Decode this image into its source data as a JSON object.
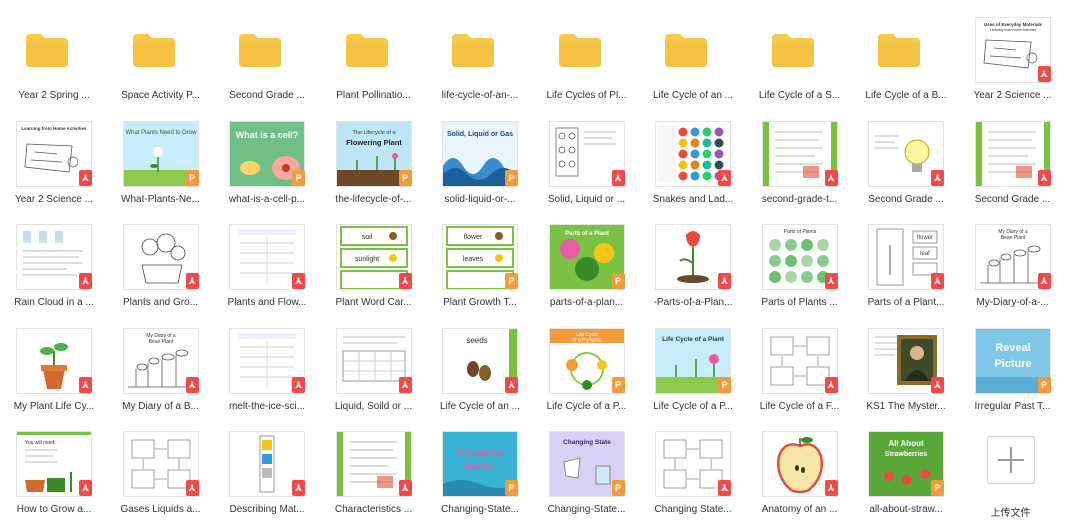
{
  "upload": {
    "label": "上传文件"
  },
  "items": [
    {
      "label": "Year 2 Spring ...",
      "kind": "folder",
      "thumb": "folder",
      "badge": ""
    },
    {
      "label": "Space Activity P...",
      "kind": "folder",
      "thumb": "folder",
      "badge": ""
    },
    {
      "label": "Second Grade ...",
      "kind": "folder",
      "thumb": "folder",
      "badge": ""
    },
    {
      "label": "Plant Pollinatio...",
      "kind": "folder",
      "thumb": "folder",
      "badge": ""
    },
    {
      "label": "life-cycle-of-an-...",
      "kind": "folder",
      "thumb": "folder",
      "badge": ""
    },
    {
      "label": "Life Cycles of Pl...",
      "kind": "folder",
      "thumb": "folder",
      "badge": ""
    },
    {
      "label": "Life Cycle of an ...",
      "kind": "folder",
      "thumb": "folder",
      "badge": ""
    },
    {
      "label": "Life Cycle of a S...",
      "kind": "folder",
      "thumb": "folder",
      "badge": ""
    },
    {
      "label": "Life Cycle of a B...",
      "kind": "folder",
      "thumb": "folder",
      "badge": ""
    },
    {
      "label": "Year 2 Science ...",
      "kind": "pdf",
      "thumb": "doc-sketch",
      "badge": "pdf",
      "title": "Uses of Everyday Materials",
      "sub": "Learning from Home Activities"
    },
    {
      "label": "Year 2 Science ...",
      "kind": "pdf",
      "thumb": "doc-sketch",
      "badge": "pdf",
      "title": "Learning from Home Activities",
      "sub": ""
    },
    {
      "label": "What-Plants-Ne...",
      "kind": "ppt",
      "thumb": "green-plant",
      "badge": "ppt",
      "title": "What Plants Need to Grow",
      "sub": ""
    },
    {
      "label": "what-is-a-cell-p...",
      "kind": "ppt",
      "thumb": "cell",
      "badge": "ppt",
      "title": "What is a cell?",
      "sub": ""
    },
    {
      "label": "the-lifecycle-of-...",
      "kind": "ppt",
      "thumb": "flowering",
      "badge": "ppt",
      "title": "The Lifecycle of a",
      "sub": "Flowering Plant"
    },
    {
      "label": "solid-liquid-or-...",
      "kind": "ppt",
      "thumb": "wave",
      "badge": "ppt",
      "title": "Solid, Liquid or Gas",
      "sub": ""
    },
    {
      "label": "Solid, Liquid or ...",
      "kind": "pdf",
      "thumb": "doc-grid",
      "badge": "pdf",
      "title": "",
      "sub": ""
    },
    {
      "label": "Snakes and Lad...",
      "kind": "pdf",
      "thumb": "dots",
      "badge": "pdf",
      "title": "",
      "sub": ""
    },
    {
      "label": "second-grade-t...",
      "kind": "pdf",
      "thumb": "green-list",
      "badge": "pdf",
      "title": "",
      "sub": ""
    },
    {
      "label": "Second Grade ...",
      "kind": "pdf",
      "thumb": "bulb",
      "badge": "pdf",
      "title": "",
      "sub": ""
    },
    {
      "label": "Second Grade ...",
      "kind": "pdf",
      "thumb": "green-list",
      "badge": "pdf",
      "title": "",
      "sub": ""
    },
    {
      "label": "Rain Cloud in a ...",
      "kind": "pdf",
      "thumb": "doc-text",
      "badge": "pdf",
      "title": "",
      "sub": ""
    },
    {
      "label": "Plants and Gro...",
      "kind": "pdf",
      "thumb": "sketch-flowers",
      "badge": "pdf",
      "title": "",
      "sub": ""
    },
    {
      "label": "Plants and Flow...",
      "kind": "pdf",
      "thumb": "doc-lines",
      "badge": "pdf",
      "title": "",
      "sub": ""
    },
    {
      "label": "Plant Word Car...",
      "kind": "pdf",
      "thumb": "word-cards",
      "badge": "pdf",
      "title": "soil",
      "sub": "sunlight"
    },
    {
      "label": "Plant Growth T...",
      "kind": "ppt",
      "thumb": "word-cards",
      "badge": "ppt",
      "title": "flower",
      "sub": "leaves"
    },
    {
      "label": "parts-of-a-plan...",
      "kind": "ppt",
      "thumb": "garden",
      "badge": "ppt",
      "title": "Parts of a Plant",
      "sub": ""
    },
    {
      "label": "-Parts-of-a-Plan...",
      "kind": "pdf",
      "thumb": "tulip",
      "badge": "pdf",
      "title": "",
      "sub": ""
    },
    {
      "label": "Parts of Plants ...",
      "kind": "pdf",
      "thumb": "plants-grid",
      "badge": "pdf",
      "title": "Parts of Plants",
      "sub": ""
    },
    {
      "label": "Parts of a Plant...",
      "kind": "pdf",
      "thumb": "doc-plant",
      "badge": "pdf",
      "title": "flower",
      "sub": "leaf"
    },
    {
      "label": "My-Diary-of-a-...",
      "kind": "pdf",
      "thumb": "sketch-bean",
      "badge": "pdf",
      "title": "My Diary of a",
      "sub": "Bean Plant"
    },
    {
      "label": "My Plant Life Cy...",
      "kind": "pdf",
      "thumb": "pot",
      "badge": "pdf",
      "title": "",
      "sub": ""
    },
    {
      "label": "My Diary of a B...",
      "kind": "pdf",
      "thumb": "sketch-bean",
      "badge": "pdf",
      "title": "My Diary of a",
      "sub": "Bean Plant"
    },
    {
      "label": "melt-the-ice-sci...",
      "kind": "pdf",
      "thumb": "doc-lines",
      "badge": "pdf",
      "title": "",
      "sub": ""
    },
    {
      "label": "Liquid, Soild or ...",
      "kind": "pdf",
      "thumb": "doc-table",
      "badge": "pdf",
      "title": "",
      "sub": ""
    },
    {
      "label": "Life Cycle of an ...",
      "kind": "pdf",
      "thumb": "seeds",
      "badge": "pdf",
      "title": "seeds",
      "sub": ""
    },
    {
      "label": "Life Cycle of a P...",
      "kind": "ppt",
      "thumb": "pumpkin",
      "badge": "ppt",
      "title": "Life Cycle",
      "sub": "of a Pumpkin"
    },
    {
      "label": "Life Cycle of a P...",
      "kind": "ppt",
      "thumb": "plant-cycle",
      "badge": "ppt",
      "title": "Life Cycle of a Plant",
      "sub": ""
    },
    {
      "label": "Life Cycle of a F...",
      "kind": "pdf",
      "thumb": "doc-cycle",
      "badge": "pdf",
      "title": "",
      "sub": ""
    },
    {
      "label": "KS1 The Myster...",
      "kind": "pdf",
      "thumb": "mona",
      "badge": "pdf",
      "title": "",
      "sub": ""
    },
    {
      "label": "Irregular Past T...",
      "kind": "ppt",
      "thumb": "reveal",
      "badge": "ppt",
      "title": "Reveal",
      "sub": "Picture"
    },
    {
      "label": "How to Grow a...",
      "kind": "pdf",
      "thumb": "grow",
      "badge": "pdf",
      "title": "You will need:",
      "sub": ""
    },
    {
      "label": "Gases Liquids a...",
      "kind": "pdf",
      "thumb": "doc-cycle",
      "badge": "pdf",
      "title": "",
      "sub": ""
    },
    {
      "label": "Describing Mat...",
      "kind": "pdf",
      "thumb": "doc-strip",
      "badge": "pdf",
      "title": "",
      "sub": ""
    },
    {
      "label": "Characteristics ...",
      "kind": "pdf",
      "thumb": "green-list",
      "badge": "pdf",
      "title": "",
      "sub": ""
    },
    {
      "label": "Changing-State...",
      "kind": "ppt",
      "thumb": "changing",
      "badge": "ppt",
      "title": "Changing",
      "sub": "States"
    },
    {
      "label": "Changing-State...",
      "kind": "ppt",
      "thumb": "changing2",
      "badge": "ppt",
      "title": "Changing State",
      "sub": ""
    },
    {
      "label": "Changing State...",
      "kind": "pdf",
      "thumb": "doc-cycle",
      "badge": "pdf",
      "title": "",
      "sub": ""
    },
    {
      "label": "Anatomy of an ...",
      "kind": "pdf",
      "thumb": "apple",
      "badge": "pdf",
      "title": "",
      "sub": ""
    },
    {
      "label": "all-about-straw...",
      "kind": "ppt",
      "thumb": "straw",
      "badge": "ppt",
      "title": "All About",
      "sub": "Strawberries"
    }
  ],
  "badges": {
    "pdf": "⅄",
    "ppt": "P"
  },
  "colors": {
    "folder": "#f7c84a",
    "folder_dark": "#f0b429",
    "pdf": "#f04a4a",
    "ppt": "#f39a3b",
    "green": "#7cc242"
  }
}
